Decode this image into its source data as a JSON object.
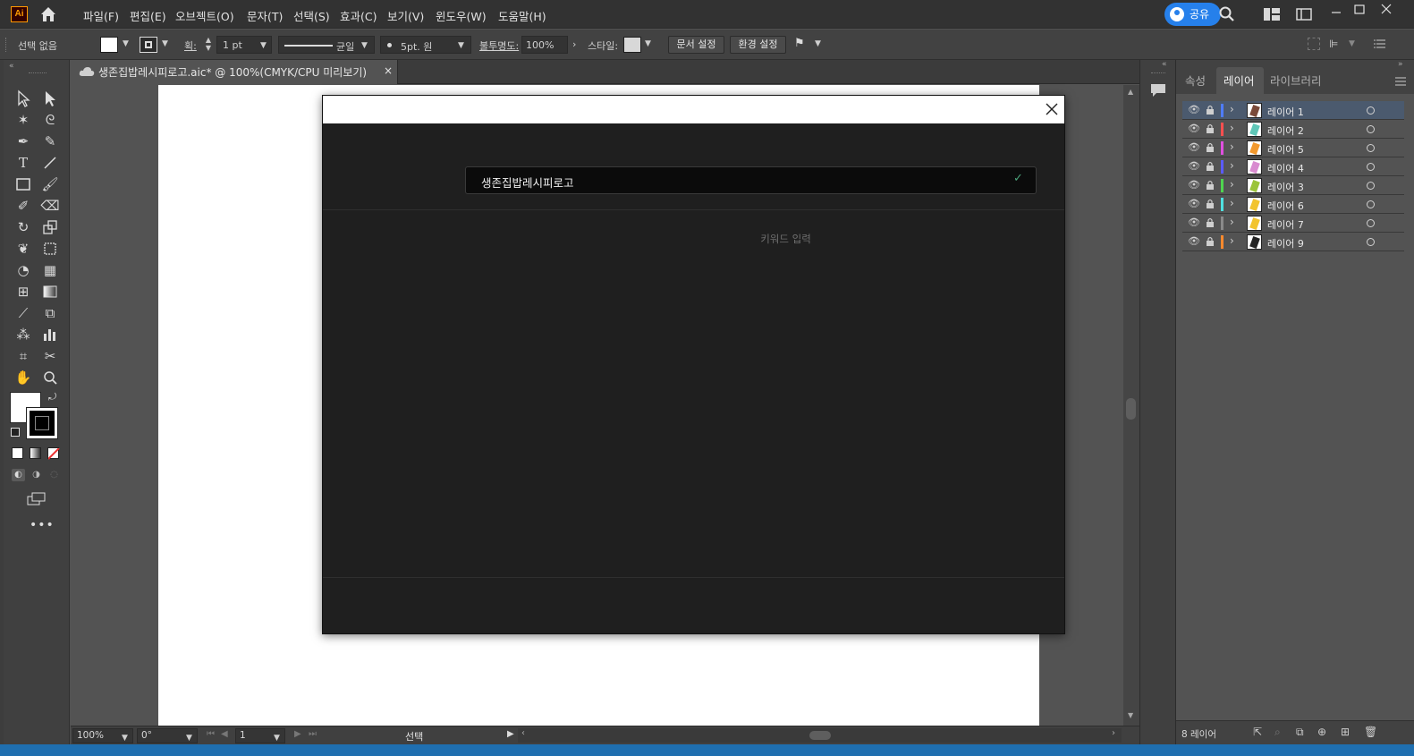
{
  "app": {
    "logo": "Ai",
    "name": "Adobe Illustrator"
  },
  "menu": [
    "파일(F)",
    "편집(E)",
    "오브젝트(O)",
    "문자(T)",
    "선택(S)",
    "효과(C)",
    "보기(V)",
    "윈도우(W)",
    "도움말(H)"
  ],
  "topright": {
    "share_label": "공유"
  },
  "control_bar": {
    "selection_status": "선택 없음",
    "stroke_label": "획:",
    "stroke_width": "1 pt",
    "stroke_profile": "균일",
    "brush": "5pt. 원",
    "opacity_label": "불투명도:",
    "opacity_value": "100%",
    "style_label": "스타일:",
    "doc_setup_label": "문서 설정",
    "prefs_label": "환경 설정"
  },
  "document_tab": {
    "title": "생존집밥레시피로고.aic* @ 100%(CMYK/CPU 미리보기)"
  },
  "status_bar": {
    "zoom": "100%",
    "rotation": "0°",
    "artboard_number": "1",
    "tool_status": "선택"
  },
  "panel": {
    "tabs": [
      "속성",
      "레이어",
      "라이브러리"
    ],
    "active_tab": "레이어",
    "layers": [
      {
        "name": "레이어 1",
        "color": "#4f7cff",
        "thumb": "#7a4a3a",
        "selected": true
      },
      {
        "name": "레이어 2",
        "color": "#ff4f4f",
        "thumb": "#5fc7b8",
        "selected": false
      },
      {
        "name": "레이어 5",
        "color": "#e04fe0",
        "thumb": "#f2992e",
        "selected": false
      },
      {
        "name": "레이어 4",
        "color": "#5b5bff",
        "thumb": "#d98bd0",
        "selected": false
      },
      {
        "name": "레이어 3",
        "color": "#4fd44f",
        "thumb": "#9bc43a",
        "selected": false
      },
      {
        "name": "레이어 6",
        "color": "#4fe0e0",
        "thumb": "#f2c42e",
        "selected": false
      },
      {
        "name": "레이어 7",
        "color": "#8a8a8a",
        "thumb": "#f2c42e",
        "selected": false
      },
      {
        "name": "레이어 9",
        "color": "#ff8a2e",
        "thumb": "#222222",
        "selected": false
      }
    ],
    "footer_count": "8 레이어"
  },
  "dialog": {
    "name_value": "생존집밥레시피로고",
    "keyword_placeholder": "키워드 입력"
  },
  "colors": {
    "accent": "#2680eb",
    "check": "#4aa37a"
  }
}
